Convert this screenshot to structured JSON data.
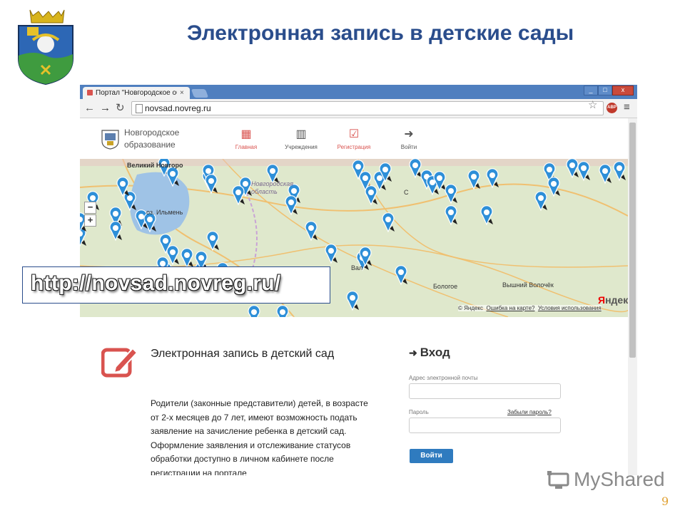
{
  "slide": {
    "title": "Электронная запись в детские сады",
    "page_number": "9",
    "url_banner": "http://novsad.novreg.ru/",
    "watermark": "MyShared"
  },
  "browser": {
    "tab_title": "Портал \"Новгородское обр",
    "tab_close": "×",
    "url": "novsad.novreg.ru",
    "window_buttons": [
      "_",
      "□",
      "x"
    ],
    "abp_label": "ABP",
    "icons": [
      "back-icon",
      "forward-icon",
      "reload-icon",
      "page-icon",
      "star-icon",
      "adblock-icon",
      "menu-icon"
    ]
  },
  "site": {
    "logo_text": "Новгородское образование",
    "nav": [
      {
        "label": "Главная",
        "icon": "grid-icon",
        "active": true
      },
      {
        "label": "Учреждения",
        "icon": "building-icon",
        "active": false
      },
      {
        "label": "Регистрация",
        "icon": "checkbox-icon",
        "active": false
      },
      {
        "label": "Войти",
        "icon": "login-icon",
        "active": false
      }
    ]
  },
  "map": {
    "labels": {
      "city_top": "Великий Новгоро",
      "lake": "оз. Ильмень",
      "region": "Новгородская область",
      "valday": "Вал",
      "bologoe": "Бологое",
      "vyshny": "Вышний Волочёк",
      "kresttsy": "С"
    },
    "zoom_in": "+",
    "zoom_out": "−",
    "provider_a": "Я",
    "provider_b": "ндекс",
    "footer_copy": "© Яндекс",
    "footer_error": "Ошибка на карте?",
    "footer_terms": "Условия использования"
  },
  "content": {
    "info_title": "Электронная запись в детский сад",
    "info_text": "Родители (законные представители) детей, в возрасте от 2-х месяцев до 7 лет, имеют возможность подать заявление на зачисление ребенка в детский сад. Оформление заявления и отслеживание статусов обработки доступно в личном кабинете после регистрации на портале",
    "login_title": "Вход",
    "email_label": "Адрес электронной почты",
    "password_label": "Пароль",
    "forgot_link": "Забыли пароль?",
    "login_button": "Войти"
  },
  "colors": {
    "title": "#2a4d8c",
    "accent_red": "#d9534f",
    "button_blue": "#2f7bbf",
    "map_pin": "#2e8fd8",
    "tabstrip": "#4f7fbf"
  }
}
